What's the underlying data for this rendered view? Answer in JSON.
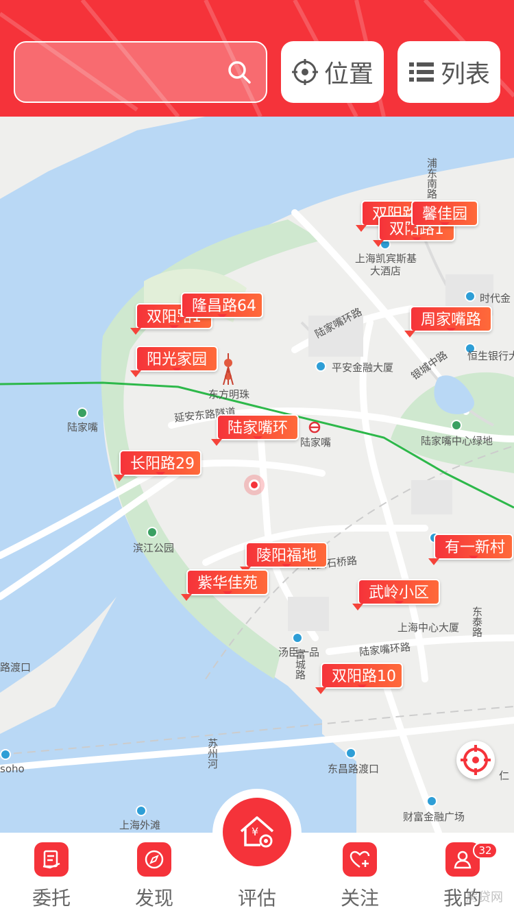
{
  "header": {
    "search": {
      "placeholder": ""
    },
    "location_label": "位置",
    "list_label": "列表"
  },
  "map": {
    "labels": {
      "pudong_hotel": "上海凯宾斯基\n大酒店",
      "kempinski_line1": "上海凯宾斯基",
      "kempinski_line2": "大酒店",
      "times_finance": "时代金",
      "lujiazui_ring_rd": "陆家嘴环路",
      "pingan": "平安金融大厦",
      "yincheng_rd": "银城中路",
      "hengsheng": "恒生银行大",
      "pearl": "东方明珠",
      "lujiazui": "陆家嘴",
      "lujiazui_station": "陆家嘴",
      "lujiazui_green": "陆家嘴中心绿地",
      "yanan_tunnel": "延安东路隧道",
      "binjiang_park": "滨江公园",
      "huayuan_rd": "花园石桥路",
      "sh_center": "上海中心大厦",
      "tangchen": "汤臣一品",
      "ring_rd2": "陆家嘴环路",
      "dongtai_rd": "东泰路",
      "ferry_left": "路渡口",
      "soho": "soho",
      "suzhou_river": "苏州河",
      "dongchang_ferry": "东昌路渡口",
      "bund": "上海外滩",
      "fortune_plaza": "财富金融广场",
      "pudong_south": "浦东南路",
      "fucheng": "富城路",
      "ren": "仁"
    },
    "markers": [
      "双阳路",
      "馨佳园",
      "双阳路1",
      "隆昌路64",
      "双阳路1",
      "周家嘴路",
      "阳光家园",
      "陆家嘴环",
      "长阳路29",
      "有一新村",
      "陵阳福地",
      "紫华佳苑",
      "武岭小区",
      "双阳路10"
    ]
  },
  "tabs": {
    "entrust": "委托",
    "discover": "发现",
    "evaluate": "评估",
    "follow": "关注",
    "mine": "我的",
    "mine_badge": "32"
  },
  "watermark": "房贷网",
  "colors": {
    "accent": "#f5333a",
    "water": "#b9d8f5",
    "park": "#cfe8cf"
  }
}
